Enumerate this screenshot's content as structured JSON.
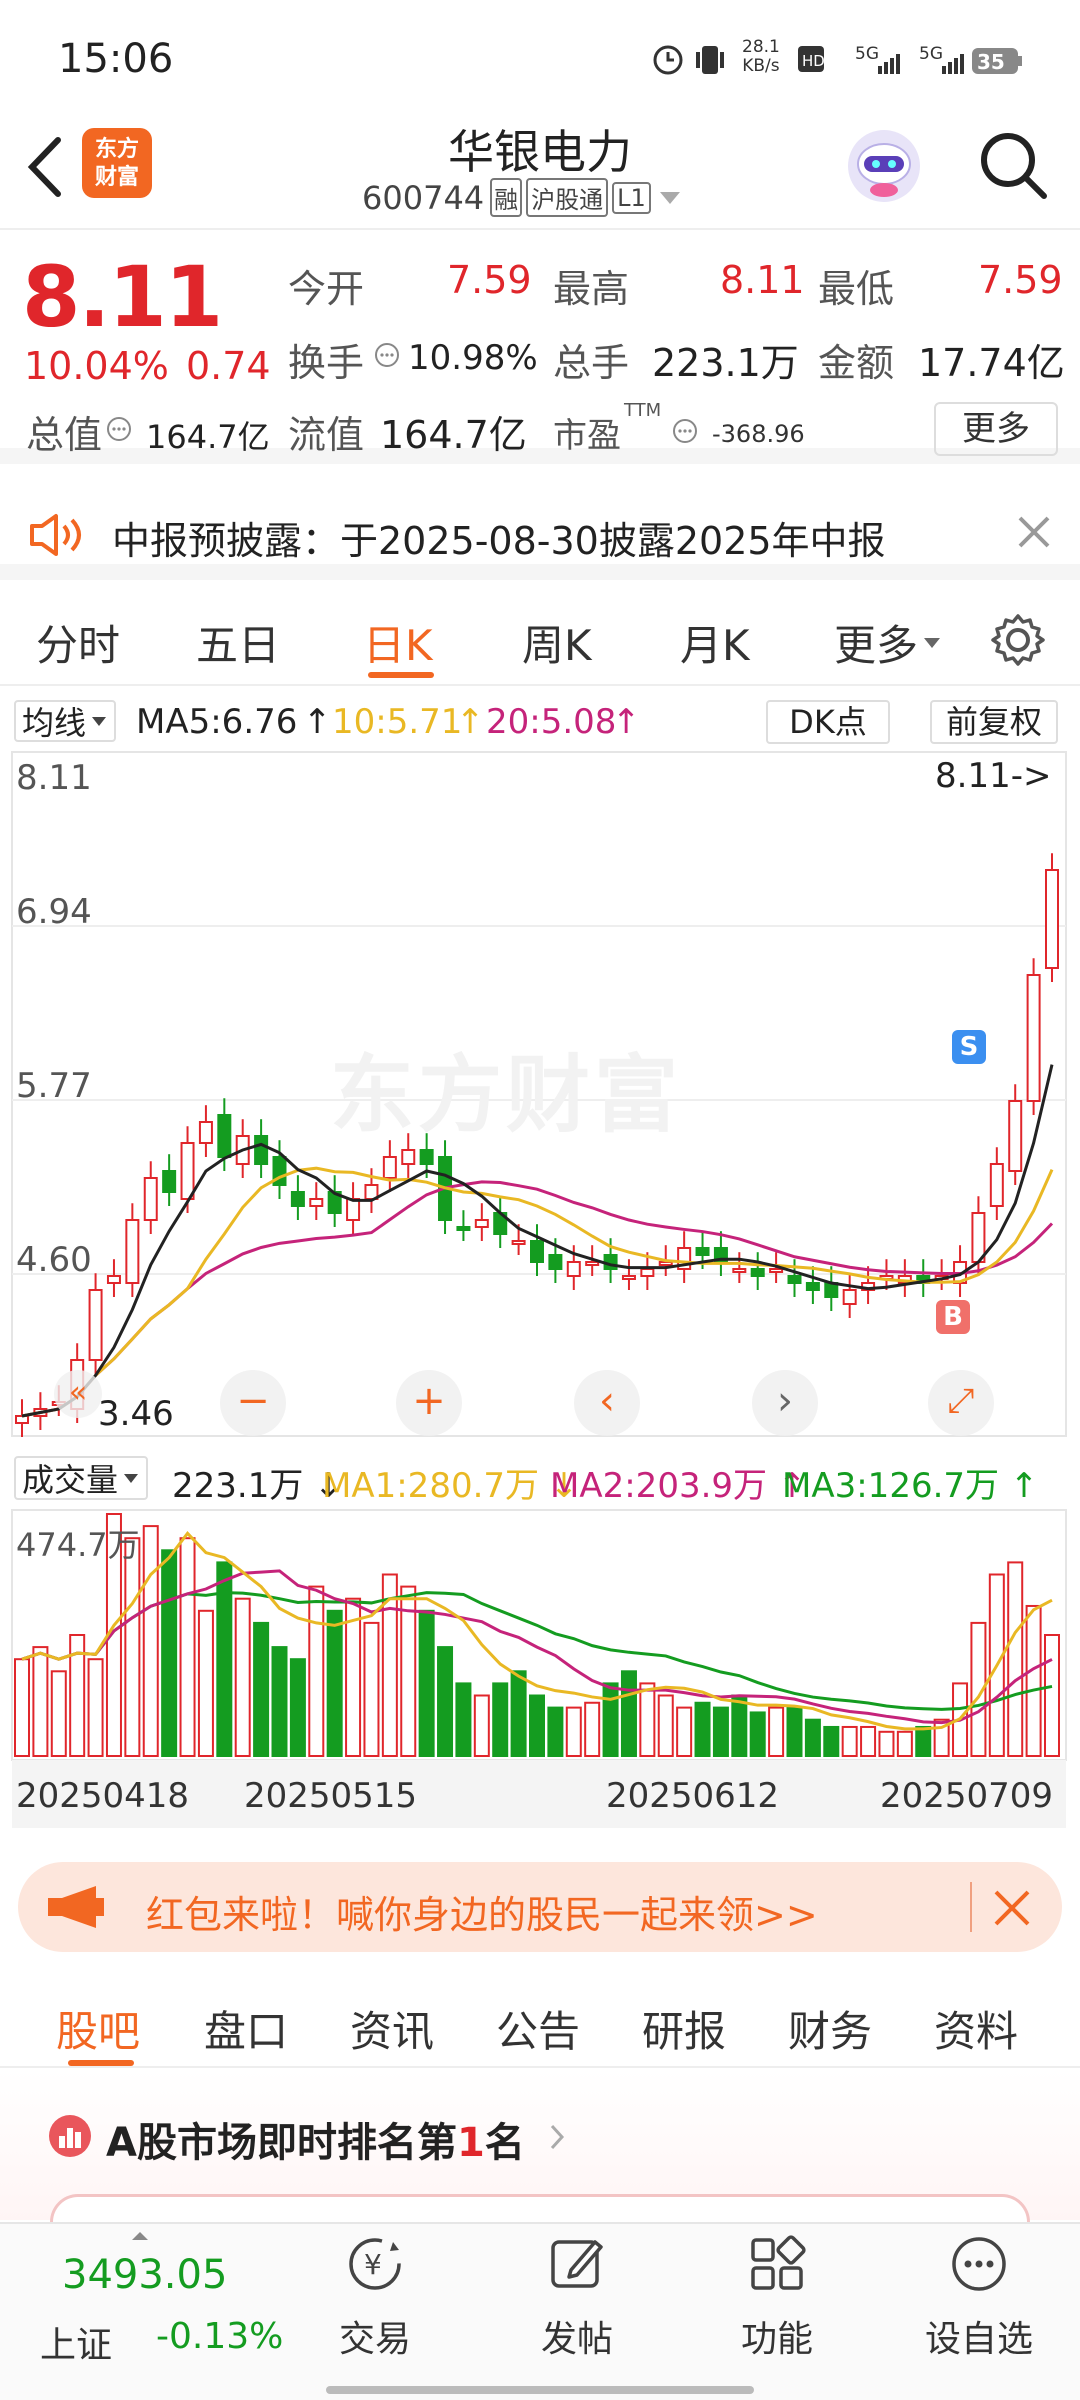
{
  "status": {
    "time": "15:06",
    "net_speed_top": "28.1",
    "net_speed_unit": "KB/s",
    "hd": "HD",
    "sig1": "5G",
    "sig2": "5G",
    "battery": "35"
  },
  "header": {
    "logo_line1": "东方",
    "logo_line2": "财富",
    "title": "华银电力",
    "code": "600744",
    "tag_rong": "融",
    "tag_hgt": "沪股通",
    "tag_l1": "L1"
  },
  "quote": {
    "price": "8.11",
    "change_pct": "10.04%",
    "change": "0.74",
    "open_label": "今开",
    "open": "7.59",
    "high_label": "最高",
    "high": "8.11",
    "low_label": "最低",
    "low": "7.59",
    "turnover_label": "换手",
    "turnover": "10.98%",
    "volume_label": "总手",
    "volume": "223.1万",
    "amount_label": "金额",
    "amount": "17.74亿",
    "mktcap_label": "总值",
    "mktcap": "164.7亿",
    "float_label": "流值",
    "float": "164.7亿",
    "pe_label": "市盈",
    "pe_sup": "TTM",
    "pe": "-368.96",
    "more_button": "更多"
  },
  "notice": {
    "text": "中报预披露：于2025-08-30披露2025年中报"
  },
  "tabs": [
    "分时",
    "五日",
    "日K",
    "周K",
    "月K",
    "更多"
  ],
  "active_tab": 2,
  "kline": {
    "indicator": "均线",
    "ma5": "MA5:6.76",
    "ma10": "10:5.71",
    "ma20": "20:5.08",
    "dk_button": "DK点",
    "adjust_button": "前复权",
    "price_labels": [
      "8.11",
      "6.94",
      "5.77",
      "4.60"
    ],
    "last_price_tag": "8.11->",
    "low_tag": "3.46",
    "watermark": "东方财富",
    "buy_tag": "B",
    "sell_tag": "S"
  },
  "volume_panel": {
    "indicator": "成交量",
    "current": "223.1万",
    "ma1": "MA1:280.7万",
    "ma2": "MA2:203.9万",
    "ma3": "MA3:126.7万",
    "max_label": "474.7万",
    "dates": [
      "20250418",
      "20250515",
      "20250612",
      "20250709"
    ]
  },
  "colors": {
    "up": "#e0262b",
    "down": "#149c20",
    "ma5": "#222222",
    "ma10": "#e9b824",
    "ma20": "#c5237a",
    "accent": "#f26722"
  },
  "banner": {
    "text": "红包来啦！喊你身边的股民一起来领>>"
  },
  "subtabs": [
    "股吧",
    "盘口",
    "资讯",
    "公告",
    "研报",
    "财务",
    "资料"
  ],
  "active_subtab": 0,
  "rank": {
    "prefix": "A股市场即时排名第",
    "num": "1",
    "suffix": "名"
  },
  "bottom": {
    "index_value": "3493.05",
    "index_name": "上证",
    "index_change": "-0.13%",
    "nav": [
      {
        "label": "交易",
        "icon": "trade-icon"
      },
      {
        "label": "发帖",
        "icon": "post-icon"
      },
      {
        "label": "功能",
        "icon": "grid-icon"
      },
      {
        "label": "设自选",
        "icon": "watchlist-icon"
      }
    ]
  }
}
